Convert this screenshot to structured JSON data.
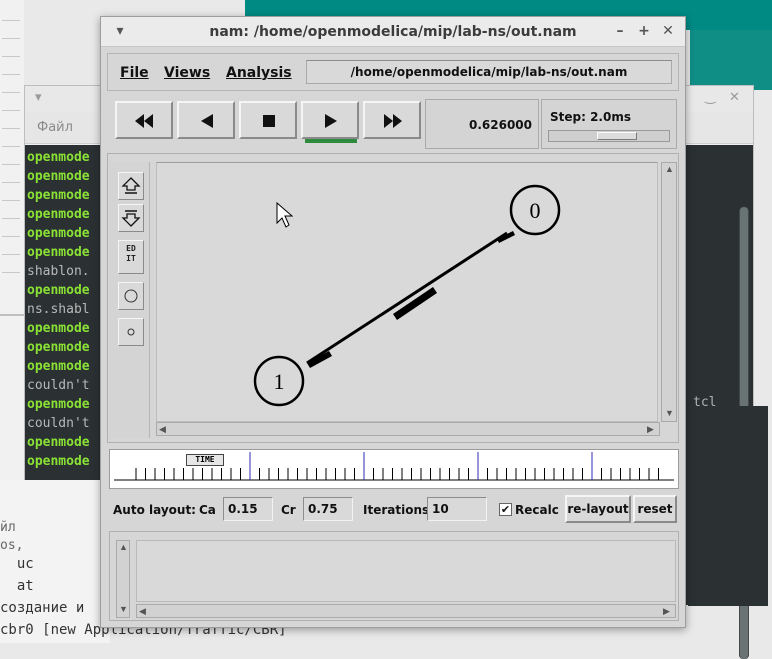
{
  "terminal": {
    "menu_label": "Файл",
    "controls": [
      "‿",
      "✕"
    ],
    "lines": [
      {
        "text": "openmode",
        "style": "green"
      },
      {
        "text": "openmode",
        "style": "green"
      },
      {
        "text": "openmode",
        "style": "green"
      },
      {
        "text": "openmode",
        "style": "green"
      },
      {
        "text": "openmode",
        "style": "green"
      },
      {
        "text": "openmode",
        "style": "green"
      },
      {
        "text": "shablon.",
        "style": "gray"
      },
      {
        "text": "openmode",
        "style": "green"
      },
      {
        "text": "ns.shabl",
        "style": "gray"
      },
      {
        "text": "openmode",
        "style": "green"
      },
      {
        "text": "openmode",
        "style": "green"
      },
      {
        "text": "openmode",
        "style": "green"
      },
      {
        "text": "couldn't",
        "style": "gray"
      },
      {
        "text": "openmode",
        "style": "green"
      },
      {
        "text": "couldn't",
        "style": "gray"
      },
      {
        "text": "openmode",
        "style": "green"
      },
      {
        "text": "openmode",
        "style": "green"
      }
    ],
    "right_text": "tcl",
    "bottom_lines": [
      "йл",
      "os,",
      "  uc",
      "  at",
      "создание и",
      "cbr0 [new Application/Traffic/CBR]"
    ]
  },
  "nam": {
    "title": "nam: /home/openmodelica/mip/lab-ns/out.nam",
    "menu": {
      "file": "File",
      "views": "Views",
      "analysis": "Analysis",
      "path": "/home/openmodelica/mip/lab-ns/out.nam"
    },
    "controls": {
      "buttons": [
        "rewind",
        "back",
        "stop",
        "play",
        "fast-forward"
      ],
      "active": "play",
      "time": "0.626000",
      "step_label": "Step: 2.0ms"
    },
    "tools": {
      "edit_label_1": "ED",
      "edit_label_2": "IT"
    },
    "nodes": [
      {
        "id": "0"
      },
      {
        "id": "1"
      }
    ],
    "timeline": {
      "marker_label": "TIME"
    },
    "layout": {
      "auto_label": "Auto layout:",
      "ca_label": "Ca",
      "ca_value": "0.15",
      "cr_label": "Cr",
      "cr_value": "0.75",
      "iter_label": "Iterations",
      "iter_value": "10",
      "recalc_label": "Recalc",
      "recalc_checked": "✔",
      "relayout_label": "re-layout",
      "reset_label": "reset"
    }
  }
}
